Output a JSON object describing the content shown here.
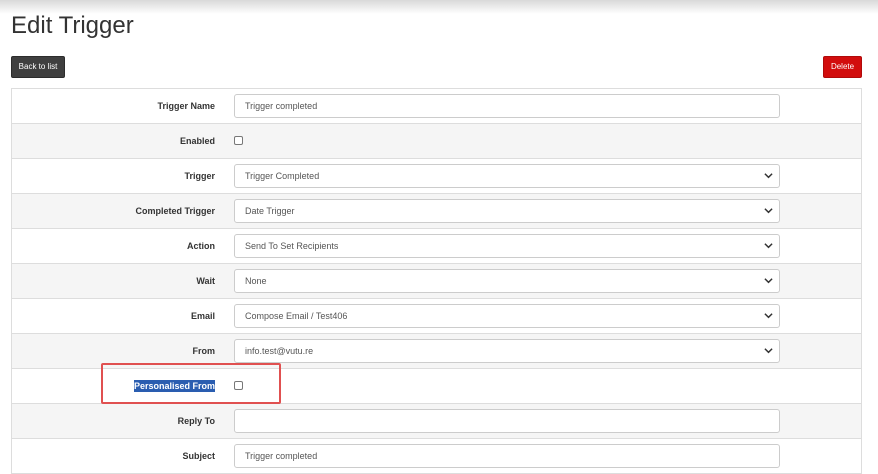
{
  "page": {
    "title": "Edit Trigger"
  },
  "toolbar": {
    "back_label": "Back to list",
    "delete_label": "Delete"
  },
  "form": {
    "trigger_name": {
      "label": "Trigger Name",
      "value": "Trigger completed"
    },
    "enabled": {
      "label": "Enabled",
      "checked": false
    },
    "trigger": {
      "label": "Trigger",
      "value": "Trigger Completed"
    },
    "completed_trigger": {
      "label": "Completed Trigger",
      "value": "Date Trigger"
    },
    "action": {
      "label": "Action",
      "value": "Send To Set Recipients"
    },
    "wait": {
      "label": "Wait",
      "value": "None"
    },
    "email": {
      "label": "Email",
      "value": "Compose Email / Test406"
    },
    "from": {
      "label": "From",
      "value": "info.test@vutu.re"
    },
    "personalised_from": {
      "label": "Personalised From",
      "checked": false
    },
    "reply_to": {
      "label": "Reply To",
      "value": ""
    },
    "subject": {
      "label": "Subject",
      "value": "Trigger completed"
    }
  },
  "colors": {
    "back_button": "#3f3f3f",
    "delete_button": "#d20d0d",
    "highlight_box": "#e05050",
    "selection": "#2a5db0"
  },
  "icons": {
    "select_caret": "chevron-down-icon"
  }
}
